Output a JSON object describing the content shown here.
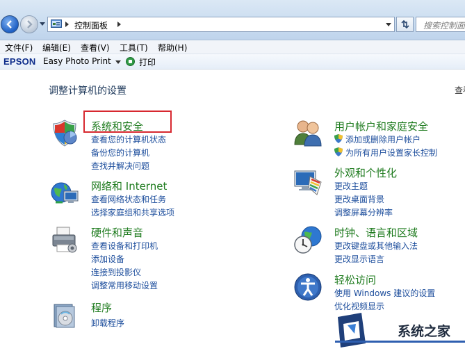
{
  "address_bar": {
    "breadcrumb": "控制面板",
    "search_placeholder": "搜索控制面"
  },
  "menu": [
    "文件(F)",
    "编辑(E)",
    "查看(V)",
    "工具(T)",
    "帮助(H)"
  ],
  "epson_toolbar": {
    "brand": "EPSON",
    "app": "Easy Photo Print",
    "print": "打印"
  },
  "page": {
    "heading": "调整计算机的设置",
    "view_by": "查看方式"
  },
  "categories": {
    "system_security": {
      "title": "系统和安全",
      "links": [
        "查看您的计算机状态",
        "备份您的计算机",
        "查找并解决问题"
      ]
    },
    "network": {
      "title": "网络和 Internet",
      "links": [
        "查看网络状态和任务",
        "选择家庭组和共享选项"
      ]
    },
    "hardware_sound": {
      "title": "硬件和声音",
      "links": [
        "查看设备和打印机",
        "添加设备",
        "连接到投影仪",
        "调整常用移动设置"
      ]
    },
    "programs": {
      "title": "程序",
      "links": [
        "卸载程序"
      ]
    },
    "user_accounts": {
      "title": "用户帐户和家庭安全",
      "links": [
        "添加或删除用户帐户",
        "为所有用户设置家长控制"
      ]
    },
    "appearance": {
      "title": "外观和个性化",
      "links": [
        "更改主题",
        "更改桌面背景",
        "调整屏幕分辨率"
      ]
    },
    "clock_region": {
      "title": "时钟、语言和区域",
      "links": [
        "更改键盘或其他输入法",
        "更改显示语言"
      ]
    },
    "ease_of_access": {
      "title": "轻松访问",
      "links": [
        "使用 Windows 建议的设置",
        "优化视频显示"
      ]
    }
  },
  "watermark": {
    "text": "系统之家"
  },
  "colors": {
    "category_title": "#1e7b1e",
    "link": "#1c4d9c",
    "highlight": "#d7282f"
  }
}
